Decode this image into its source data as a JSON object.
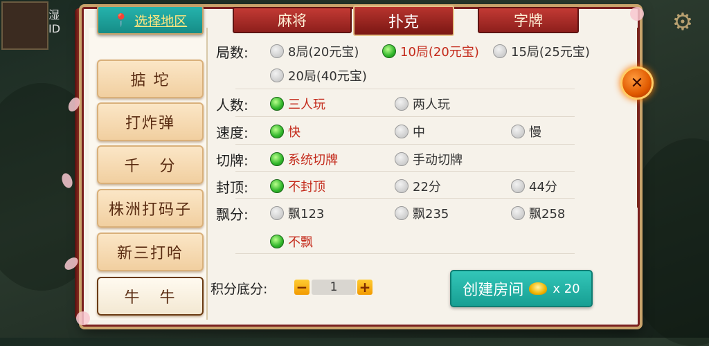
{
  "header": {
    "region_label": "选择地区",
    "id_prefix": "ID",
    "name_prefix": "湿"
  },
  "tabs": [
    {
      "label": "麻将",
      "active": false
    },
    {
      "label": "扑克",
      "active": true
    },
    {
      "label": "字牌",
      "active": false
    }
  ],
  "games": [
    {
      "label": "掂 坨",
      "selected": false
    },
    {
      "label": "打炸弹",
      "selected": false
    },
    {
      "label": "千   分",
      "selected": false
    },
    {
      "label": "株洲打码子",
      "selected": false
    },
    {
      "label": "新三打哈",
      "selected": false
    },
    {
      "label": "牛   牛",
      "selected": true
    }
  ],
  "options": {
    "rounds": {
      "label": "局数:",
      "choices": [
        {
          "text": "8局(20元宝)",
          "selected": false
        },
        {
          "text": "10局(20元宝)",
          "selected": true
        },
        {
          "text": "15局(25元宝)",
          "selected": false
        },
        {
          "text": "20局(40元宝)",
          "selected": false
        }
      ]
    },
    "players": {
      "label": "人数:",
      "choices": [
        {
          "text": "三人玩",
          "selected": true
        },
        {
          "text": "两人玩",
          "selected": false
        }
      ]
    },
    "speed": {
      "label": "速度:",
      "choices": [
        {
          "text": "快",
          "selected": true
        },
        {
          "text": "中",
          "selected": false
        },
        {
          "text": "慢",
          "selected": false
        }
      ]
    },
    "cut": {
      "label": "切牌:",
      "choices": [
        {
          "text": "系统切牌",
          "selected": true
        },
        {
          "text": "手动切牌",
          "selected": false
        }
      ]
    },
    "cap": {
      "label": "封顶:",
      "choices": [
        {
          "text": "不封顶",
          "selected": true
        },
        {
          "text": "22分",
          "selected": false
        },
        {
          "text": "44分",
          "selected": false
        }
      ]
    },
    "float": {
      "label": "飘分:",
      "choices": [
        {
          "text": "飘123",
          "selected": false
        },
        {
          "text": "飘235",
          "selected": false
        },
        {
          "text": "飘258",
          "selected": false
        },
        {
          "text": "不飘",
          "selected": true
        }
      ]
    }
  },
  "score": {
    "label": "积分底分:",
    "minus": "−",
    "plus": "+",
    "value": "1"
  },
  "create": {
    "label": "创建房间",
    "cost": "x 20"
  },
  "close_label": "✕",
  "colors": {
    "accent_teal": "#1aa79b",
    "tab_red": "#a82a25",
    "selected_text": "#c42b1c"
  }
}
